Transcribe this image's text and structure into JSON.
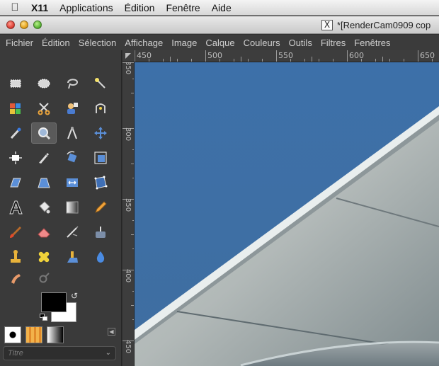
{
  "macos_menubar": {
    "apple_icon": "apple-logo-icon",
    "items": [
      "X11",
      "Applications",
      "Édition",
      "Fenêtre",
      "Aide"
    ]
  },
  "window": {
    "title": "*[RenderCam0909 cop",
    "x11_icon_glyph": "X"
  },
  "gimp_menubar": {
    "items": [
      "Fichier",
      "Édition",
      "Sélection",
      "Affichage",
      "Image",
      "Calque",
      "Couleurs",
      "Outils",
      "Filtres",
      "Fenêtres"
    ]
  },
  "toolbox": {
    "tools": [
      {
        "name": "rect-select-tool",
        "icon": "rectangle-select-icon"
      },
      {
        "name": "ellipse-select-tool",
        "icon": "ellipse-select-icon"
      },
      {
        "name": "free-select-tool",
        "icon": "lasso-icon"
      },
      {
        "name": "fuzzy-select-tool",
        "icon": "magic-wand-icon"
      },
      {
        "name": "color-select-tool",
        "icon": "select-by-color-icon"
      },
      {
        "name": "scissors-tool",
        "icon": "scissors-icon"
      },
      {
        "name": "foreground-select-tool",
        "icon": "foreground-select-icon"
      },
      {
        "name": "paths-tool",
        "icon": "paths-icon"
      },
      {
        "name": "color-picker-tool",
        "icon": "color-picker-icon"
      },
      {
        "name": "zoom-tool",
        "icon": "magnifier-icon",
        "active": true
      },
      {
        "name": "measure-tool",
        "icon": "compass-icon"
      },
      {
        "name": "move-tool",
        "icon": "move-arrows-icon"
      },
      {
        "name": "align-tool",
        "icon": "align-icon"
      },
      {
        "name": "crop-tool",
        "icon": "crop-knife-icon"
      },
      {
        "name": "rotate-tool",
        "icon": "rotate-icon"
      },
      {
        "name": "scale-tool",
        "icon": "scale-icon"
      },
      {
        "name": "shear-tool",
        "icon": "shear-icon"
      },
      {
        "name": "perspective-tool",
        "icon": "perspective-icon"
      },
      {
        "name": "flip-tool",
        "icon": "flip-icon"
      },
      {
        "name": "cage-tool",
        "icon": "cage-icon"
      },
      {
        "name": "text-tool",
        "icon": "text-a-icon"
      },
      {
        "name": "bucket-fill-tool",
        "icon": "paint-bucket-icon"
      },
      {
        "name": "blend-tool",
        "icon": "gradient-icon"
      },
      {
        "name": "pencil-tool",
        "icon": "pencil-icon"
      },
      {
        "name": "paintbrush-tool",
        "icon": "paintbrush-icon"
      },
      {
        "name": "eraser-tool",
        "icon": "eraser-icon"
      },
      {
        "name": "airbrush-tool",
        "icon": "airbrush-icon"
      },
      {
        "name": "ink-tool",
        "icon": "ink-pen-icon"
      },
      {
        "name": "clone-tool",
        "icon": "clone-stamp-icon"
      },
      {
        "name": "heal-tool",
        "icon": "heal-bandage-icon"
      },
      {
        "name": "perspective-clone-tool",
        "icon": "perspective-clone-icon"
      },
      {
        "name": "blur-sharpen-tool",
        "icon": "water-drop-icon"
      },
      {
        "name": "smudge-tool",
        "icon": "smudge-finger-icon"
      },
      {
        "name": "dodge-burn-tool",
        "icon": "dodge-burn-icon"
      }
    ],
    "colors": {
      "foreground": "#000000",
      "background": "#ffffff"
    },
    "title_select_placeholder": "Titre"
  },
  "rulers": {
    "horizontal_labels": [
      "450",
      "500",
      "550",
      "600",
      "650"
    ],
    "vertical_labels": [
      "350",
      "300",
      "350",
      "400",
      "450"
    ]
  },
  "theme": {
    "sky": "#3e6fa6",
    "panel": "#3a3a3a"
  }
}
